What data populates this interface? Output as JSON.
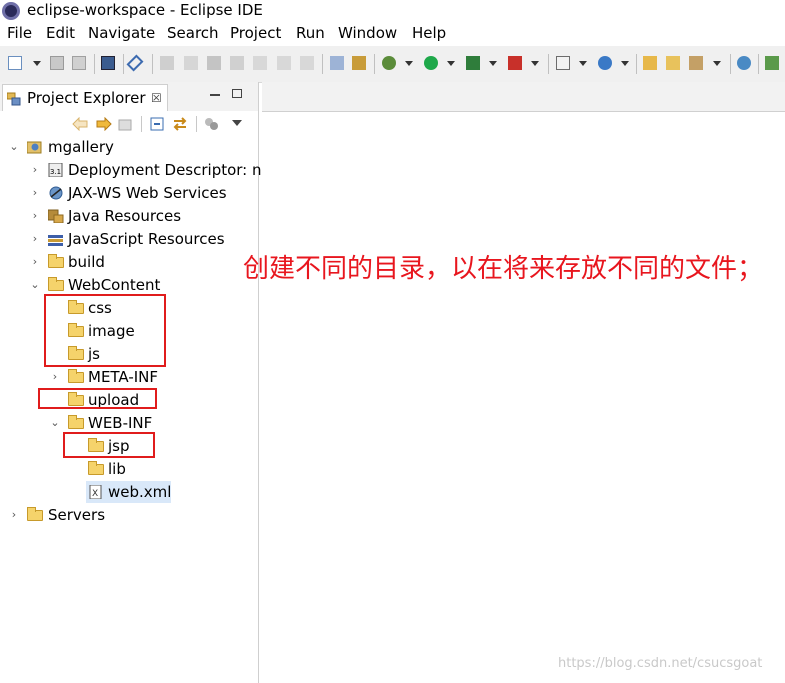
{
  "window": {
    "title": "eclipse-workspace - Eclipse IDE"
  },
  "menu": [
    "File",
    "Edit",
    "Navigate",
    "Search",
    "Project",
    "Run",
    "Window",
    "Help"
  ],
  "view": {
    "tab_label": "Project Explorer",
    "close_glyph": "☒"
  },
  "tree": {
    "project": "mgallery",
    "deployment_descriptor": "Deployment Descriptor: n",
    "jaxws": "JAX-WS Web Services",
    "java_resources": "Java Resources",
    "js_resources": "JavaScript Resources",
    "build": "build",
    "webcontent": "WebContent",
    "css": "css",
    "image": "image",
    "js": "js",
    "meta_inf": "META-INF",
    "upload": "upload",
    "web_inf": "WEB-INF",
    "jsp": "jsp",
    "lib": "lib",
    "web_xml": "web.xml",
    "servers": "Servers"
  },
  "annotation": "创建不同的目录，以在将来存放不同的文件；",
  "watermark": "https://blog.csdn.net/csucsgoat",
  "colors": {
    "annotation": "#e8161e",
    "selection": "#d9e8f9",
    "folder": "#f5d36b"
  }
}
